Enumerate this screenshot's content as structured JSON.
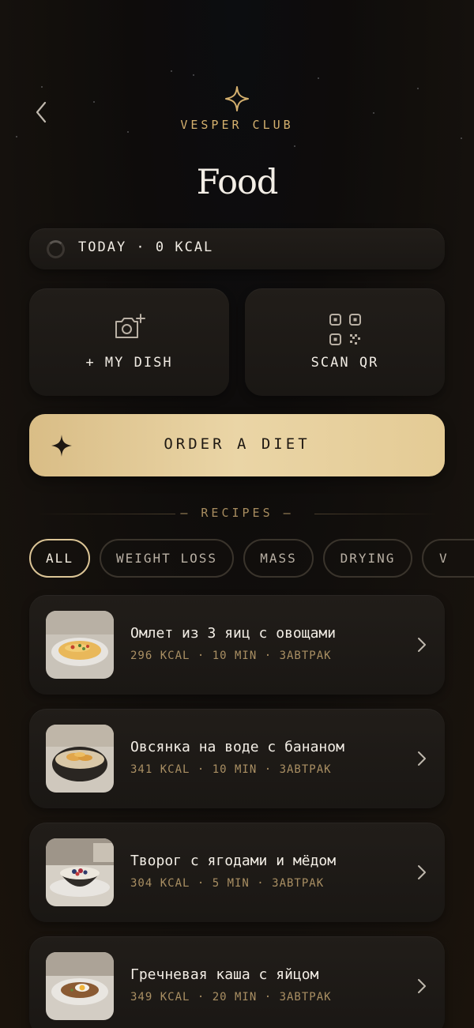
{
  "header": {
    "brand": "VESPER CLUB",
    "title": "Food"
  },
  "today": {
    "label": "TODAY · 0 KCAL",
    "progress": 0
  },
  "actions": {
    "my_dish": {
      "label": "+ MY DISH",
      "icon": "camera-plus-icon"
    },
    "scan_qr": {
      "label": "SCAN QR",
      "icon": "qr-code-icon"
    }
  },
  "order": {
    "label": "ORDER A DIET",
    "icon": "sparkle-icon"
  },
  "recipes_heading": "— RECIPES —",
  "filters": [
    {
      "label": "ALL",
      "active": true
    },
    {
      "label": "WEIGHT LOSS",
      "active": false
    },
    {
      "label": "MASS",
      "active": false
    },
    {
      "label": "DRYING",
      "active": false
    },
    {
      "label": "V",
      "active": false
    }
  ],
  "recipes": [
    {
      "name": "Омлет из 3 яиц с овощами",
      "meta": "296 KCAL · 10 MIN · ЗАВТРАК"
    },
    {
      "name": "Овсянка на воде с бананом",
      "meta": "341 KCAL · 10 MIN · ЗАВТРАК"
    },
    {
      "name": "Творог с ягодами и мёдом",
      "meta": "304 KCAL · 5 MIN · ЗАВТРАК"
    },
    {
      "name": "Гречневая каша с яйцом",
      "meta": "349 KCAL · 20 MIN · ЗАВТРАК"
    }
  ],
  "colors": {
    "accent_gold": "#d4b06e",
    "order_button": "#e4cb95",
    "background": "#15110d"
  }
}
